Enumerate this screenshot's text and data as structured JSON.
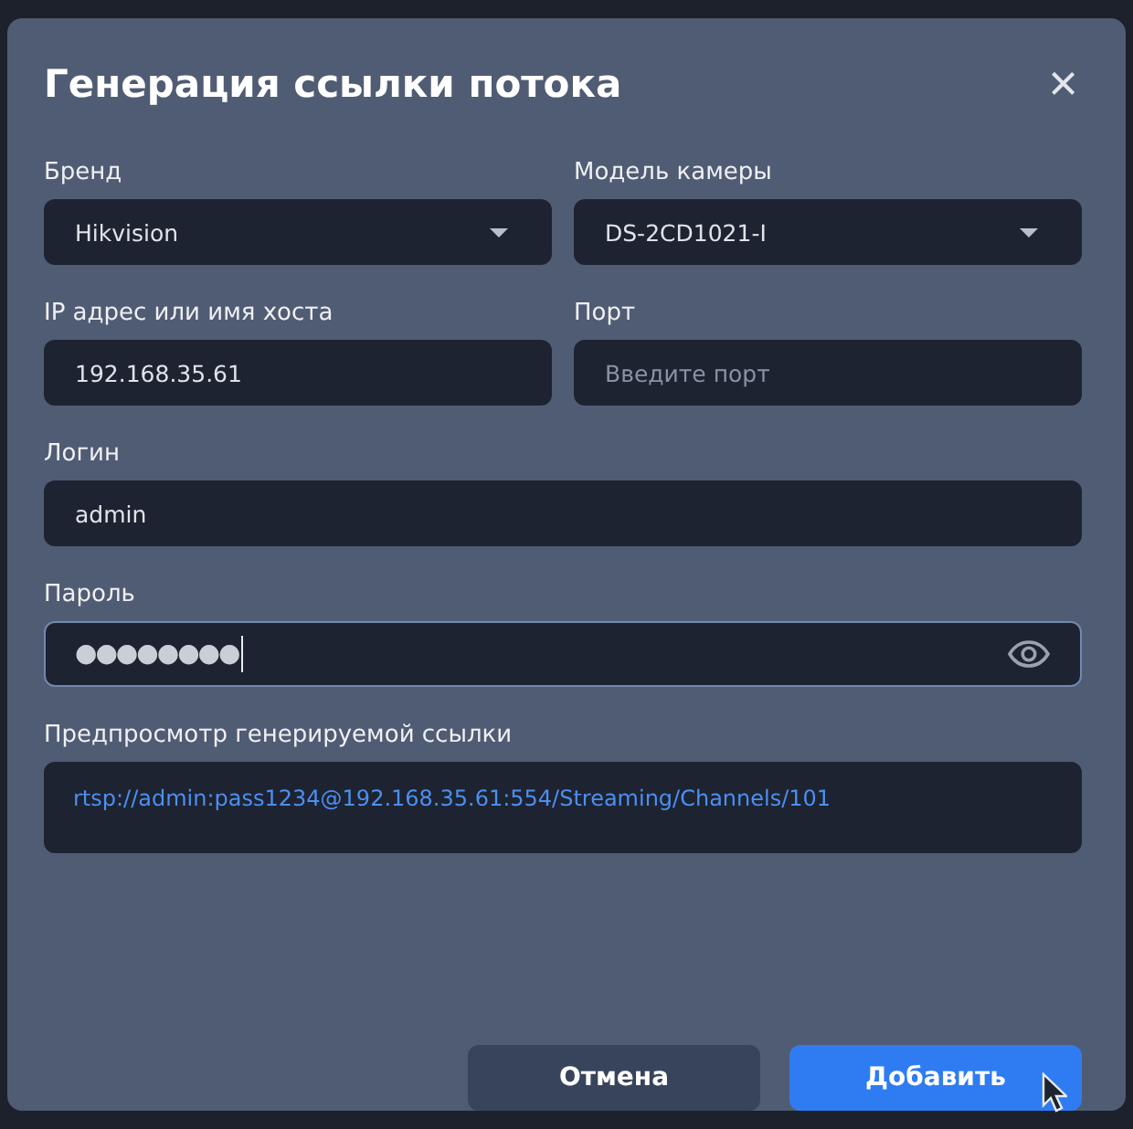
{
  "dialog": {
    "title": "Генерация ссылки потока",
    "close": "×"
  },
  "rows": [
    {
      "fields": [
        {
          "kind": "select",
          "label": "Бренд",
          "value": "Hikvision"
        },
        {
          "kind": "select",
          "label": "Модель камеры",
          "value": "DS-2CD1021-I"
        }
      ]
    },
    {
      "fields": [
        {
          "kind": "text",
          "label": "IP адрес или имя хоста",
          "value": "192.168.35.61"
        },
        {
          "kind": "text",
          "label": "Порт",
          "placeholder": "Введите порт"
        }
      ]
    },
    {
      "fields": [
        {
          "kind": "text",
          "label": "Логин",
          "value": "admin"
        }
      ]
    },
    {
      "fields": [
        {
          "kind": "password",
          "label": "Пароль",
          "masked_value": "●●●●●●●●",
          "focused": true
        }
      ]
    }
  ],
  "preview": {
    "label": "Предпросмотр генерируемой ссылки",
    "link": "rtsp://admin:pass1234@192.168.35.61:554/Streaming/Channels/101"
  },
  "buttons": [
    {
      "kind": "secondary",
      "label": "Отмена"
    },
    {
      "kind": "primary",
      "label": "Добавить"
    }
  ]
}
